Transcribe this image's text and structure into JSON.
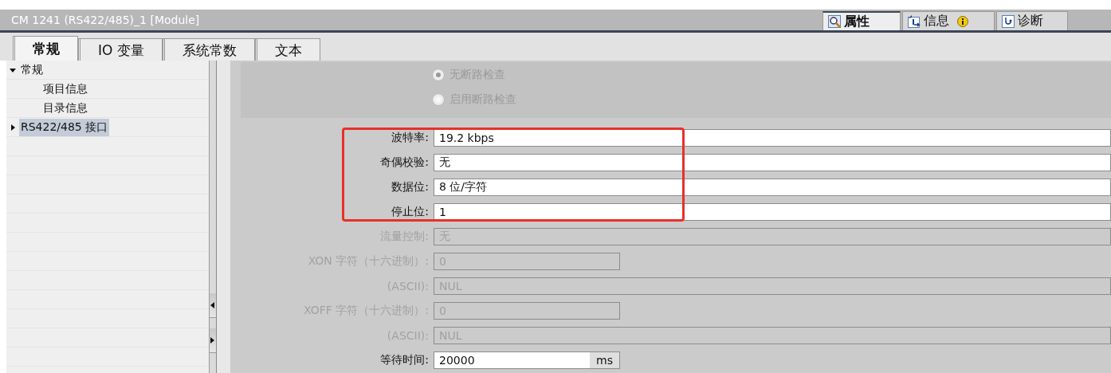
{
  "window": {
    "title": "CM 1241 (RS422/485)_1 [Module]"
  },
  "inspector_tabs": [
    {
      "label": "属性",
      "kind": "properties",
      "selected": true,
      "badge": false
    },
    {
      "label": "信息",
      "kind": "info",
      "selected": false,
      "badge": true
    },
    {
      "label": "诊断",
      "kind": "diagnostics",
      "selected": false,
      "badge": false
    }
  ],
  "tabs": [
    {
      "label": "常规",
      "selected": true
    },
    {
      "label": "IO 变量",
      "selected": false
    },
    {
      "label": "系统常数",
      "selected": false
    },
    {
      "label": "文本",
      "selected": false
    }
  ],
  "tree": [
    {
      "label": "常规",
      "expanded": true,
      "selected": false,
      "children": [
        {
          "label": "项目信息",
          "selected": false
        },
        {
          "label": "目录信息",
          "selected": false
        }
      ]
    },
    {
      "label": "RS422/485 接口",
      "expanded": false,
      "selected": true
    }
  ],
  "radios": [
    {
      "label": "无断路检查",
      "selected": true,
      "disabled": true
    },
    {
      "label": "启用断路检查",
      "selected": false,
      "disabled": true
    }
  ],
  "fields": [
    {
      "label": "波特率:",
      "value": "19.2 kbps",
      "kind": "wide",
      "disabled": false
    },
    {
      "label": "奇偶校验:",
      "value": "无",
      "kind": "wide",
      "disabled": false
    },
    {
      "label": "数据位:",
      "value": "8 位/字符",
      "kind": "wide",
      "disabled": false
    },
    {
      "label": "停止位:",
      "value": "1",
      "kind": "wide",
      "disabled": false
    },
    {
      "label": "流量控制:",
      "value": "无",
      "kind": "wide",
      "disabled": true
    },
    {
      "label": "XON 字符（十六进制）:",
      "value": "0",
      "kind": "short",
      "disabled": true
    },
    {
      "label": "(ASCII):",
      "value": "NUL",
      "kind": "wide",
      "disabled": true
    },
    {
      "label": "XOFF 字符（十六进制）:",
      "value": "0",
      "kind": "short",
      "disabled": true
    },
    {
      "label": "(ASCII):",
      "value": "NUL",
      "kind": "wide",
      "disabled": true
    },
    {
      "label": "等待时间:",
      "value": "20000",
      "kind": "unit",
      "unit": "ms",
      "disabled": false
    }
  ]
}
